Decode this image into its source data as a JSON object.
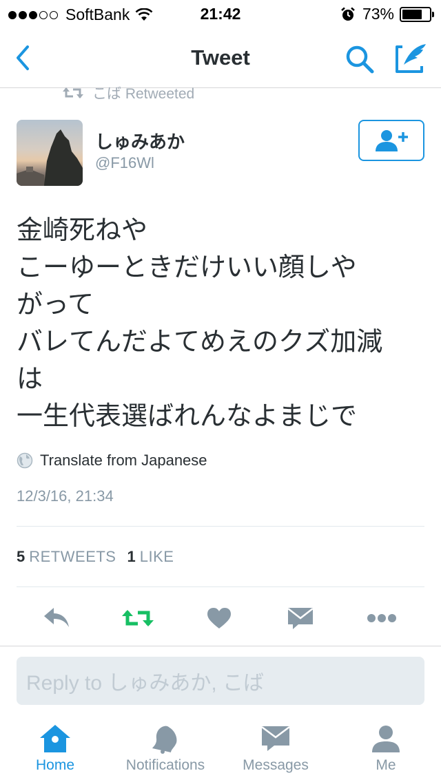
{
  "status_bar": {
    "signal_bars_filled": 3,
    "signal_bars_total": 5,
    "carrier": "SoftBank",
    "time": "21:42",
    "battery_percent": "73%",
    "battery_level": 0.73
  },
  "nav": {
    "title": "Tweet",
    "back_icon": "chevron-left-icon",
    "search_icon": "search-icon",
    "compose_icon": "compose-quill-icon"
  },
  "retweeted_by": {
    "text": "こば Retweeted",
    "icon": "retweet-icon"
  },
  "tweet": {
    "display_name": "しゅみあか",
    "screen_name": "@F16Wl",
    "follow_icon": "follow-user-plus-icon",
    "text_lines": [
      "金崎死ねや",
      "こーゆーときだけいい顔しや",
      "がって",
      "バレてんだよてめえのクズ加減",
      "は",
      "一生代表選ばれんなよまじで"
    ],
    "translate_label": "Translate from Japanese",
    "timestamp": "12/3/16, 21:34",
    "retweet_count": "5",
    "retweet_label": "RETWEETS",
    "like_count": "1",
    "like_label": "LIKE"
  },
  "actions": {
    "reply": "reply-icon",
    "retweet": "retweet-icon",
    "like": "heart-icon",
    "dm": "envelope-icon",
    "more": "more-dots-icon",
    "retweeted_color": "#17bf63"
  },
  "reply_box": {
    "placeholder": "Reply to しゅみあか, こば"
  },
  "tab_bar": {
    "items": [
      {
        "label": "Home",
        "icon": "home-icon",
        "active": true
      },
      {
        "label": "Notifications",
        "icon": "bell-icon",
        "active": false
      },
      {
        "label": "Messages",
        "icon": "envelope-icon",
        "active": false
      },
      {
        "label": "Me",
        "icon": "person-icon",
        "active": false
      }
    ]
  },
  "colors": {
    "accent": "#1b95e0",
    "muted": "#8899a6",
    "icon_gray": "#8899a6",
    "retweet_green": "#17bf63"
  }
}
